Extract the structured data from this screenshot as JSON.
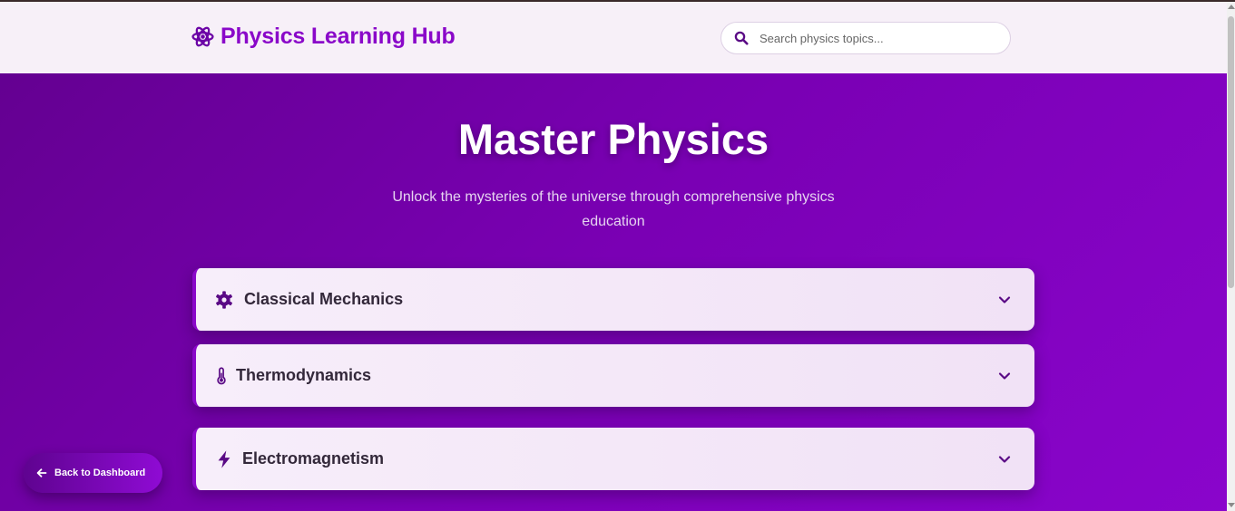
{
  "header": {
    "logo_text": "Physics Learning Hub",
    "logo_icon": "atom-icon",
    "search": {
      "placeholder": "Search physics topics...",
      "value": ""
    }
  },
  "hero": {
    "title": "Master Physics",
    "subtitle": "Unlock the mysteries of the universe through comprehensive physics education"
  },
  "topics": [
    {
      "label": "Classical Mechanics",
      "icon": "gear-icon"
    },
    {
      "label": "Thermodynamics",
      "icon": "thermometer-icon"
    },
    {
      "label": "Electromagnetism",
      "icon": "lightning-icon"
    }
  ],
  "back_button": {
    "label": "Back to Dashboard",
    "icon": "arrow-left-icon"
  },
  "colors": {
    "brand": "#8a08c9",
    "background_start": "#62008e",
    "background_end": "#8a05cc",
    "card_bg": "#f7eefa",
    "header_bg": "#f7f0f8"
  }
}
